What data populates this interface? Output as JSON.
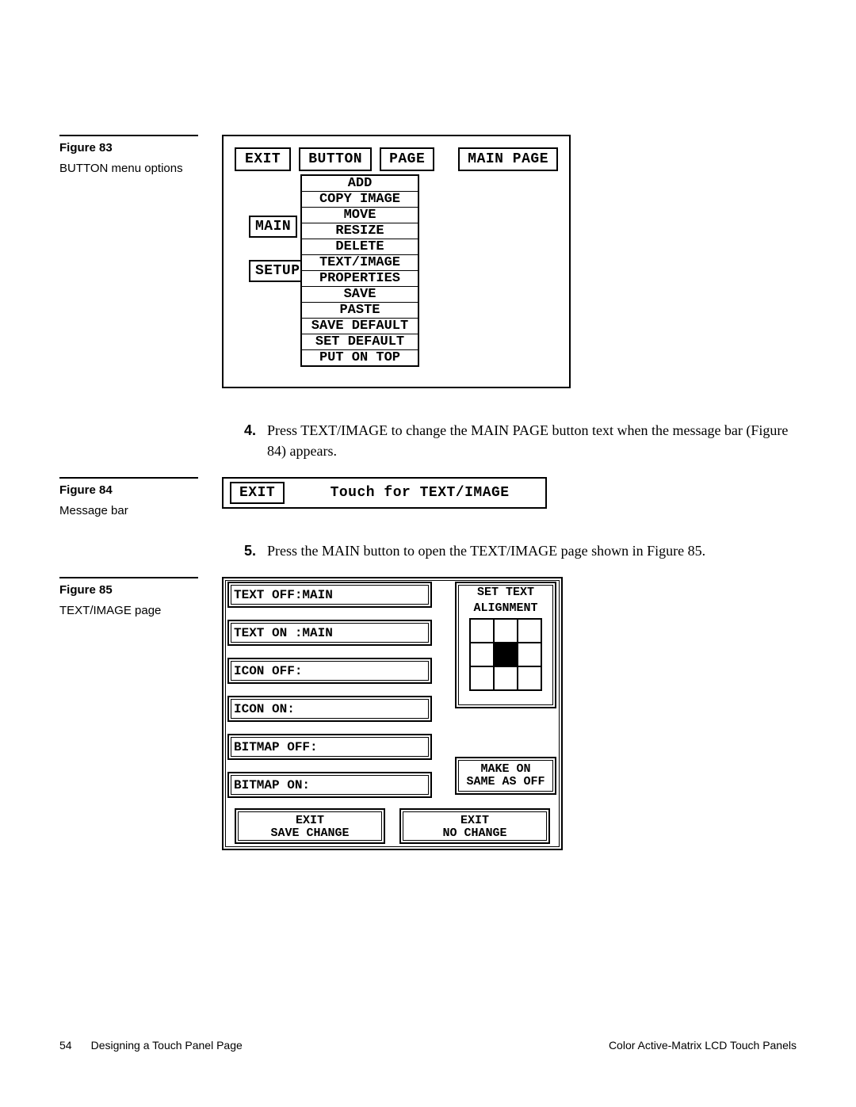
{
  "figures": {
    "f83": {
      "title": "Figure 83",
      "caption": "BUTTON menu options"
    },
    "f84": {
      "title": "Figure 84",
      "caption": "Message bar"
    },
    "f85": {
      "title": "Figure 85",
      "caption": "TEXT/IMAGE page"
    }
  },
  "fig83": {
    "exit": "EXIT",
    "button": "BUTTON",
    "page": "PAGE",
    "mainpage": "MAIN PAGE",
    "main": "MAIN",
    "setup": "SETUP",
    "menu": [
      "ADD",
      "COPY IMAGE",
      "MOVE",
      "RESIZE",
      "DELETE",
      "TEXT/IMAGE",
      "PROPERTIES",
      "SAVE",
      "PASTE",
      "SAVE DEFAULT",
      "SET DEFAULT",
      "PUT ON TOP"
    ]
  },
  "steps": {
    "s4num": "4.",
    "s4text": "Press TEXT/IMAGE to change the MAIN PAGE button text when the message bar (Figure 84) appears.",
    "s5num": "5.",
    "s5text": "Press the  MAIN button to open the TEXT/IMAGE page shown in Figure 85."
  },
  "fig84": {
    "exit": "EXIT",
    "message": "Touch for TEXT/IMAGE"
  },
  "fig85": {
    "text_off": "TEXT OFF:MAIN",
    "text_on": "TEXT ON :MAIN",
    "icon_off": "ICON OFF:",
    "icon_on": "ICON ON:",
    "bitmap_off": "BITMAP OFF:",
    "bitmap_on": "BITMAP ON:",
    "align_label1": "SET TEXT",
    "align_label2": "ALIGNMENT",
    "make_on1": "MAKE ON",
    "make_on2": "SAME AS OFF",
    "exit_save1": "EXIT",
    "exit_save2": "SAVE CHANGE",
    "exit_no1": "EXIT",
    "exit_no2": "NO CHANGE"
  },
  "footer": {
    "page": "54",
    "left": "Designing a Touch Panel Page",
    "right": "Color Active-Matrix LCD Touch Panels"
  }
}
